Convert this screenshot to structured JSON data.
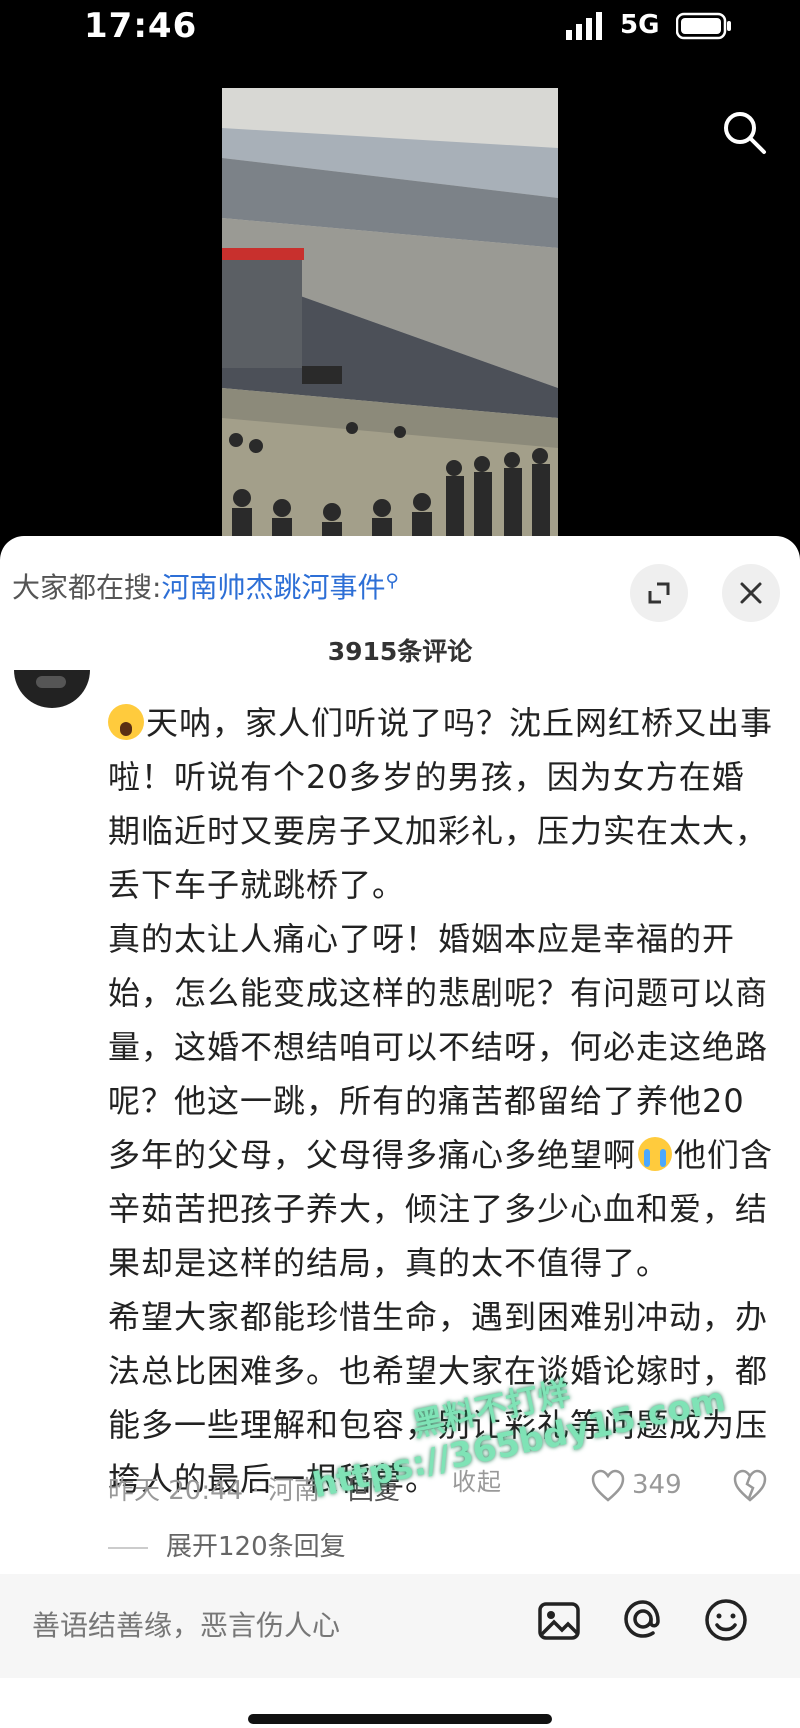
{
  "status_bar": {
    "time": "17:46",
    "network": "5G",
    "icons": [
      "signal-icon",
      "battery-icon"
    ]
  },
  "video": {
    "icons": [
      "search-icon"
    ]
  },
  "sheet": {
    "search": {
      "prefix": "大家都在搜:",
      "keyword": "河南帅杰跳河事件"
    },
    "icons": [
      "expand-icon",
      "close-icon"
    ],
    "comment_count": "3915条评论",
    "comment": {
      "lines": [
        "天呐，家人们听说了吗？沈丘网红桥又出事啦！听说有个20多岁的男孩，因为女方在婚期临近时又要房子又加彩礼，压力实在太大，丢下车子就跳桥了。",
        "真的太让人痛心了呀！婚姻本应是幸福的开始，怎么能变成这样的悲剧呢？有问题可以商量，这婚不想结咱可以不结呀，何必走这绝路呢？他这一跳，所有的痛苦都留给了养他20多年的父母，父母得多痛心多绝望啊",
        "他们含辛茹苦把孩子养大，倾注了多少心血和爱，结果却是这样的结局，真的太不值得了。",
        "希望大家都能珍惜生命，遇到困难别冲动，办法总比困难多。也希望大家在谈婚论嫁时，都能多一些理解和包容，别让彩礼等问题成为压垮人的最后一根稻草。"
      ],
      "collapse": "收起",
      "time_location": "昨天 20:44 · 河南",
      "reply": "回复",
      "like_count": "349",
      "expand_replies": "展开120条回复"
    }
  },
  "watermark": {
    "line1": "黑料不打烊",
    "line2": "https://365bdy15.com"
  },
  "input_bar": {
    "placeholder": "善语结善缘，恶言伤人心",
    "icons": [
      "image-icon",
      "at-icon",
      "emoji-icon"
    ]
  }
}
